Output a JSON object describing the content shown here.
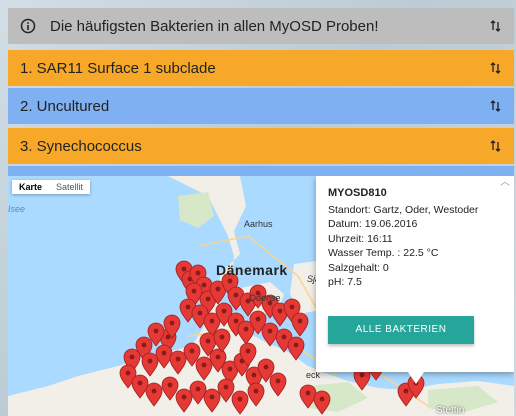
{
  "header": {
    "title": "Die häufigsten Bakterien in allen MyOSD Proben!"
  },
  "panels": [
    {
      "label": "1. SAR11 Surface 1 subclade"
    },
    {
      "label": "2. Uncultured"
    },
    {
      "label": "3. Synechococcus"
    }
  ],
  "colors": {
    "orange": "#f7a829",
    "blue": "#7fb0f2",
    "header": "#bdbdbd",
    "button": "#26a69a",
    "pin": "#e53935"
  },
  "map": {
    "type_map": "Karte",
    "type_satellite": "Satellit",
    "labels": {
      "denmark": "Dänemark",
      "aarhus": "Aarhus",
      "odense": "Odense",
      "isee": "Isee",
      "stettin": "Stettin",
      "sjae": "Sjæ",
      "eck": "eck"
    },
    "info": {
      "station": "MYOSD810",
      "standort": "Standort: Gartz, Oder, Westoder",
      "datum": "Datum: 19.06.2016",
      "uhrzeit": "Uhrzeit: 16:11",
      "wasser_temp": "Wasser Temp. : 22.5 °C",
      "salzgehalt": "Salzgehalt: 0",
      "ph": "pH: 7.5",
      "button": "Alle Bakterien"
    }
  }
}
